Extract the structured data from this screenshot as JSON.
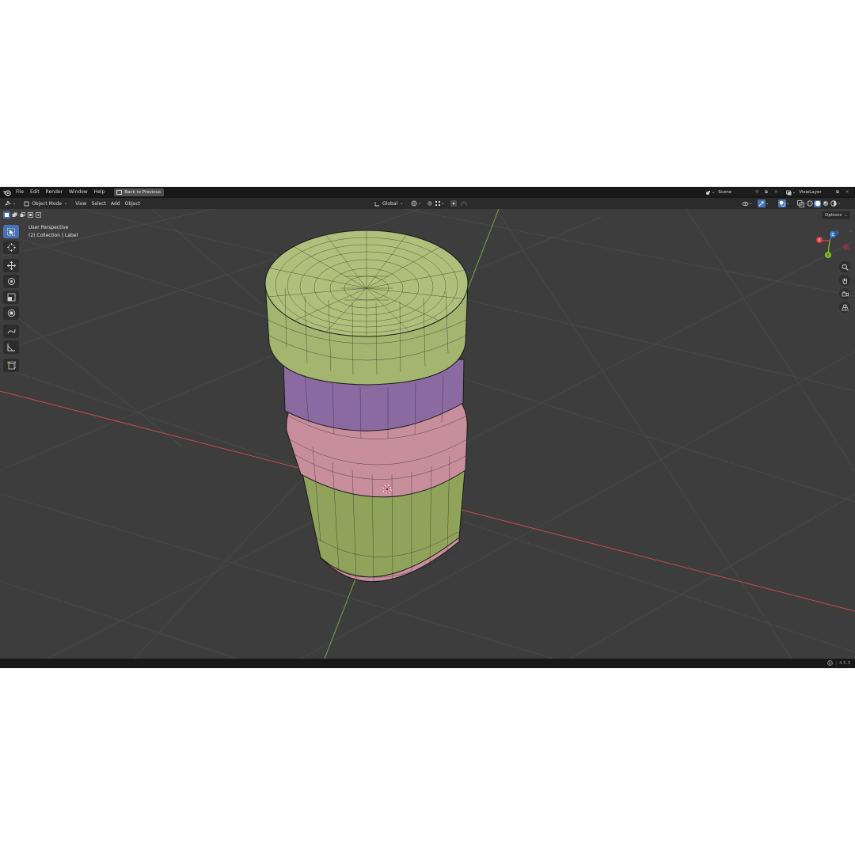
{
  "menu": {
    "file": "File",
    "edit": "Edit",
    "render": "Render",
    "window": "Window",
    "help": "Help",
    "back_to_previous": "Back to Previous"
  },
  "topbar": {
    "scene": "Scene",
    "view_layer": "ViewLayer"
  },
  "header": {
    "mode": "Object Mode",
    "view": "View",
    "select": "Select",
    "add": "Add",
    "object": "Object",
    "transform_orientation": "Global",
    "options": "Options"
  },
  "viewport": {
    "perspective_label": "User Perspective",
    "collection_label": "(2) Collection | Label"
  },
  "gizmo": {
    "x": "X",
    "y": "Y",
    "z": "Z"
  },
  "status": {
    "version": "4.5.3"
  },
  "colors": {
    "active_tool": "#4772b3",
    "x_axis": "#d9404c",
    "y_axis": "#7fbf2a",
    "z_axis": "#3b7fd9",
    "cap_green": "#a3b56f",
    "label_green": "#8fa35a",
    "ring_purple": "#8a6aa0",
    "body_pink": "#c88e9c"
  }
}
